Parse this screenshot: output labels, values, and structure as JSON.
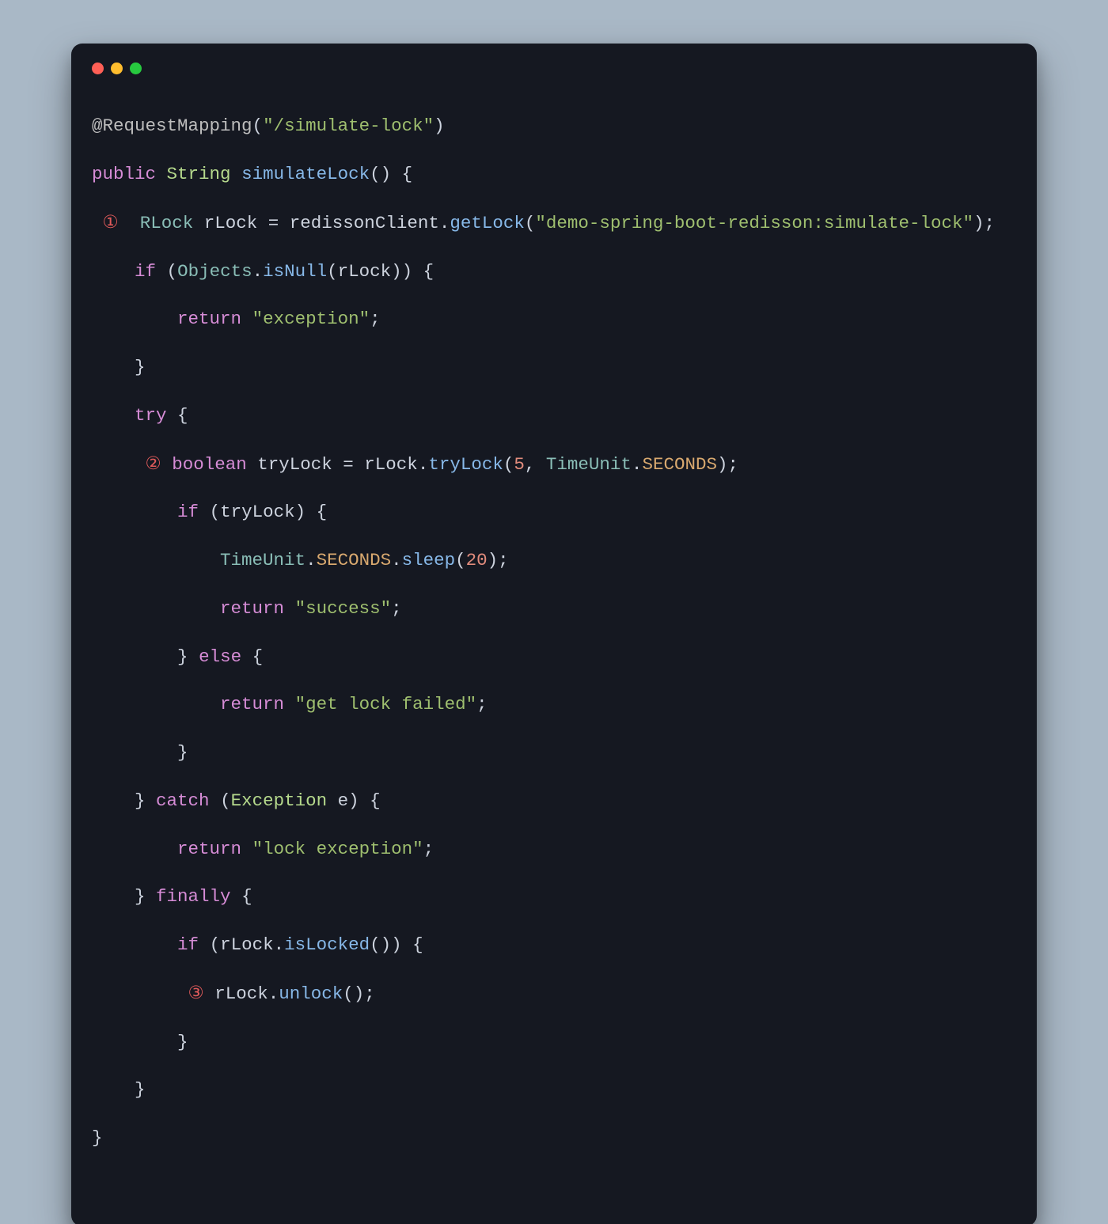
{
  "window": {
    "buttons": [
      "close",
      "minimize",
      "zoom"
    ]
  },
  "circled": {
    "one": "①",
    "two": "②",
    "three": "③"
  },
  "code": {
    "l1": {
      "annot": "@RequestMapping",
      "p1": "(",
      "s1": "\"/simulate-lock\"",
      "p2": ")"
    },
    "l2": {
      "kw1": "public",
      "sp1": " ",
      "ty": "String",
      "sp2": " ",
      "fn": "simulateLock",
      "p": "() {"
    },
    "l3": {
      "lead": " ",
      "mark": "①",
      "sp": "  ",
      "ty": "RLock",
      "sp2": " ",
      "v": "rLock",
      "sp3": " ",
      "eq": "=",
      "sp4": " ",
      "obj": "redissonClient",
      "dot": ".",
      "fn": "getLock",
      "p1": "(",
      "s": "\"demo-spring-boot-redisson:simulate-lock\"",
      "p2": ");"
    },
    "l4": {
      "lead": "    ",
      "kw": "if",
      "sp": " ",
      "p1": "(",
      "ty": "Objects",
      "dot": ".",
      "fn": "isNull",
      "p2": "(",
      "v": "rLock",
      "p3": ")) {"
    },
    "l5": {
      "lead": "        ",
      "kw": "return",
      "sp": " ",
      "s": "\"exception\"",
      "p": ";"
    },
    "l6": {
      "lead": "    ",
      "p": "}"
    },
    "l7": {
      "lead": "    ",
      "kw": "try",
      "sp": " ",
      "p": "{"
    },
    "l8": {
      "lead": "     ",
      "mark": "②",
      "sp": " ",
      "kw": "boolean",
      "sp2": " ",
      "v": "tryLock",
      "sp3": " ",
      "eq": "=",
      "sp4": " ",
      "obj": "rLock",
      "dot": ".",
      "fn": "tryLock",
      "p1": "(",
      "n": "5",
      "c": ", ",
      "ty": "TimeUnit",
      "dot2": ".",
      "en": "SECONDS",
      "p2": ");"
    },
    "l9": {
      "lead": "        ",
      "kw": "if",
      "sp": " ",
      "p1": "(",
      "v": "tryLock",
      "p2": ") {"
    },
    "l10": {
      "lead": "            ",
      "ty": "TimeUnit",
      "dot": ".",
      "en": "SECONDS",
      "dot2": ".",
      "fn": "sleep",
      "p1": "(",
      "n": "20",
      "p2": ");"
    },
    "l11": {
      "lead": "            ",
      "kw": "return",
      "sp": " ",
      "s": "\"success\"",
      "p": ";"
    },
    "l12": {
      "lead": "        ",
      "p": "}",
      "sp": " ",
      "kw": "else",
      "sp2": " ",
      "p2": "{"
    },
    "l13": {
      "lead": "            ",
      "kw": "return",
      "sp": " ",
      "s": "\"get lock failed\"",
      "p": ";"
    },
    "l14": {
      "lead": "        ",
      "p": "}"
    },
    "l15": {
      "lead": "    ",
      "p": "}",
      "sp": " ",
      "kw": "catch",
      "sp2": " ",
      "p2": "(",
      "ty": "Exception",
      "sp3": " ",
      "v": "e",
      "p3": ") {"
    },
    "l16": {
      "lead": "        ",
      "kw": "return",
      "sp": " ",
      "s": "\"lock exception\"",
      "p": ";"
    },
    "l17": {
      "lead": "    ",
      "p": "}",
      "sp": " ",
      "kw": "finally",
      "sp2": " ",
      "p2": "{"
    },
    "l18": {
      "lead": "        ",
      "kw": "if",
      "sp": " ",
      "p1": "(",
      "v": "rLock",
      "dot": ".",
      "fn": "isLocked",
      "p2": "()) {"
    },
    "l19": {
      "lead": "         ",
      "mark": "③",
      "sp": " ",
      "v": "rLock",
      "dot": ".",
      "fn": "unlock",
      "p": "();"
    },
    "l20": {
      "lead": "        ",
      "p": "}"
    },
    "l21": {
      "lead": "    ",
      "p": "}"
    },
    "l22": {
      "p": "}"
    }
  }
}
